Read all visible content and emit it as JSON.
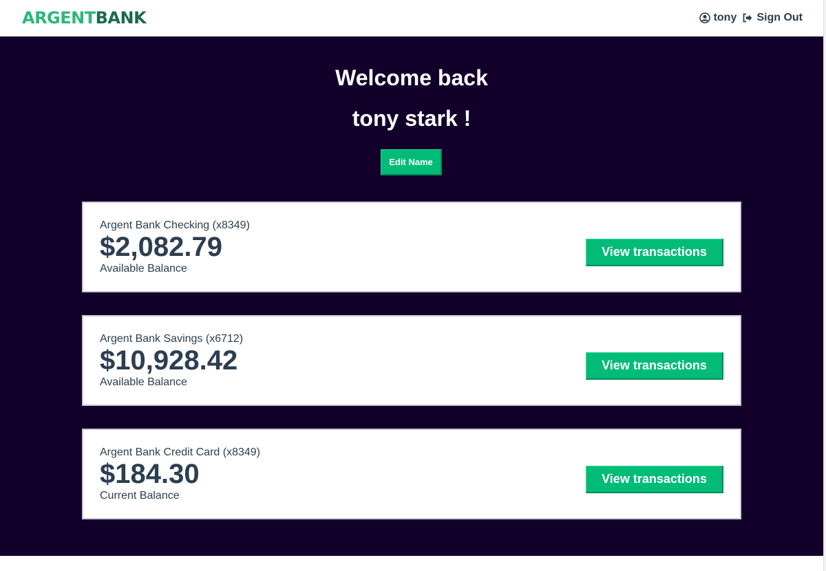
{
  "nav": {
    "logo_part1": "ARGENT",
    "logo_part2": "BANK",
    "user_icon": "user-circle-icon",
    "user_label": "tony",
    "signout_icon": "sign-out-icon",
    "signout_label": "Sign Out"
  },
  "header": {
    "welcome": "Welcome back",
    "username": "tony stark !",
    "edit_label": "Edit Name"
  },
  "accounts": [
    {
      "title": "Argent Bank Checking (x8349)",
      "amount": "$2,082.79",
      "description": "Available Balance",
      "button": "View transactions"
    },
    {
      "title": "Argent Bank Savings (x6712)",
      "amount": "$10,928.42",
      "description": "Available Balance",
      "button": "View transactions"
    },
    {
      "title": "Argent Bank Credit Card (x8349)",
      "amount": "$184.30",
      "description": "Current Balance",
      "button": "View transactions"
    }
  ],
  "colors": {
    "accent": "#00bc77",
    "background_dark": "#12002b",
    "text": "#2c3e50"
  }
}
